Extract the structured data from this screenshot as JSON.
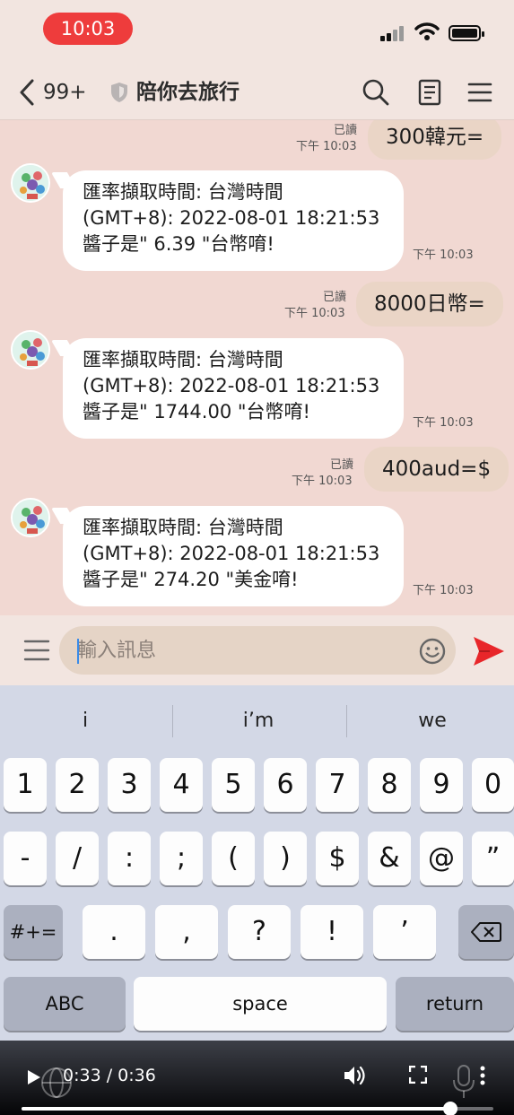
{
  "status_bar": {
    "time": "10:03"
  },
  "header": {
    "back_count": "99+",
    "title": "陪你去旅行"
  },
  "messages": [
    {
      "type": "out",
      "text": "300韓元=",
      "read": "已讀",
      "time": "下午 10:03"
    },
    {
      "type": "in",
      "lines": [
        "匯率擷取時間: 台灣時間",
        "(GMT+8): 2022-08-01 18:21:53",
        "醬子是\" 6.39 \"台幣唷!"
      ],
      "time": "下午 10:03"
    },
    {
      "type": "out",
      "text": "8000日幣=",
      "read": "已讀",
      "time": "下午 10:03"
    },
    {
      "type": "in",
      "lines": [
        "匯率擷取時間: 台灣時間",
        "(GMT+8): 2022-08-01 18:21:53",
        "醬子是\" 1744.00 \"台幣唷!"
      ],
      "time": "下午 10:03"
    },
    {
      "type": "out",
      "text": "400aud=$",
      "read": "已讀",
      "time": "下午 10:03"
    },
    {
      "type": "in",
      "lines": [
        "匯率擷取時間: 台灣時間",
        "(GMT+8): 2022-08-01 18:21:53",
        "醬子是\" 274.20 \"美金唷!"
      ],
      "time": "下午 10:03"
    }
  ],
  "input": {
    "placeholder": "輸入訊息"
  },
  "keyboard": {
    "suggestions": [
      "i",
      "i’m",
      "we"
    ],
    "row1": [
      "1",
      "2",
      "3",
      "4",
      "5",
      "6",
      "7",
      "8",
      "9",
      "0"
    ],
    "row2": [
      "-",
      "/",
      ":",
      ";",
      "(",
      ")",
      "$",
      "&",
      "@",
      "”"
    ],
    "row3": [
      ".",
      ",",
      "?",
      "!",
      "’"
    ],
    "symbols_key": "#+=",
    "abc_key": "ABC",
    "space_key": "space",
    "return_key": "return"
  },
  "video": {
    "elapsed": "0:33 / 0:36",
    "progress": 0.909
  },
  "colors": {
    "status_pill": "#ee3c3c",
    "chat_bg": "#f1d8d2",
    "send": "#e8262a"
  }
}
